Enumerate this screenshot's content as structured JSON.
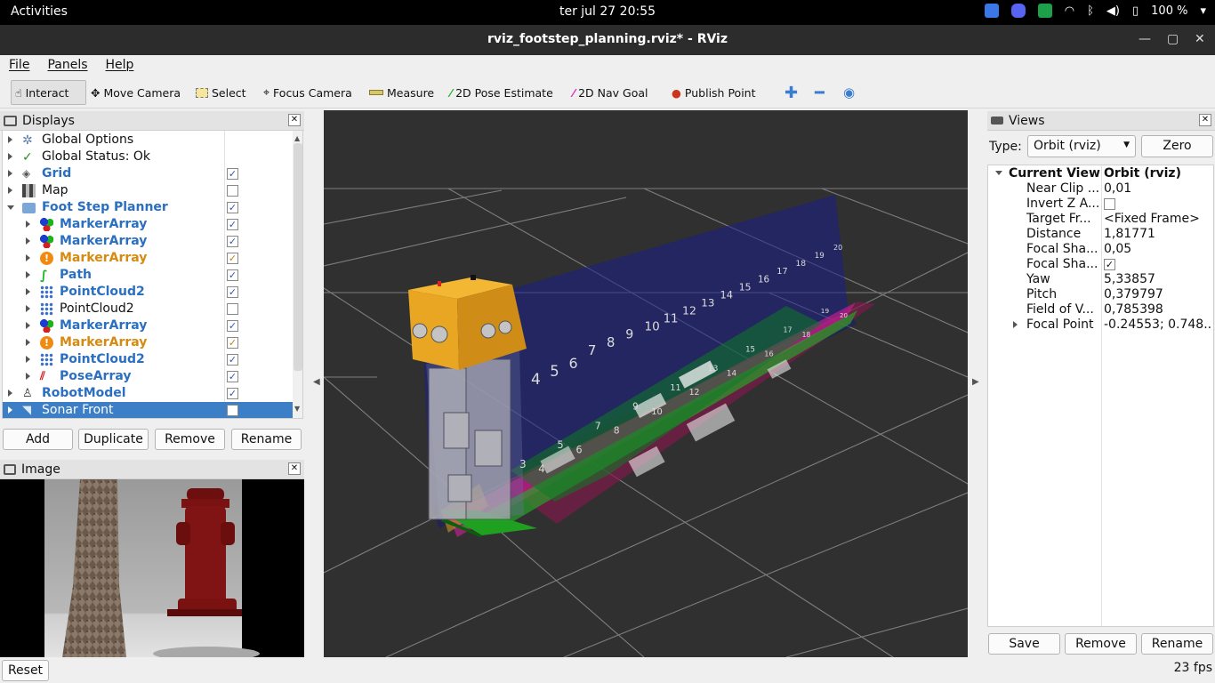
{
  "system_bar": {
    "activities": "Activities",
    "clock": "ter jul 27  20:55",
    "battery": "100 %"
  },
  "window": {
    "title": "rviz_footstep_planning.rviz* - RViz"
  },
  "menu": [
    "File",
    "Panels",
    "Help"
  ],
  "toolbar": {
    "interact": "Interact",
    "move_camera": "Move Camera",
    "select": "Select",
    "focus_camera": "Focus Camera",
    "measure": "Measure",
    "pose_estimate": "2D Pose Estimate",
    "nav_goal": "2D Nav Goal",
    "publish_point": "Publish Point"
  },
  "displays": {
    "title": "Displays",
    "items": [
      {
        "label": "Global Options"
      },
      {
        "label": "Global Status: Ok"
      },
      {
        "label": "Grid",
        "checked": true
      },
      {
        "label": "Map",
        "checked": false
      },
      {
        "label": "Foot Step Planner",
        "checked": true
      },
      {
        "label": "MarkerArray",
        "checked": true
      },
      {
        "label": "MarkerArray",
        "checked": true
      },
      {
        "label": "MarkerArray",
        "checked": true
      },
      {
        "label": "Path",
        "checked": true
      },
      {
        "label": "PointCloud2",
        "checked": true
      },
      {
        "label": "PointCloud2",
        "checked": false
      },
      {
        "label": "MarkerArray",
        "checked": true
      },
      {
        "label": "MarkerArray",
        "checked": true
      },
      {
        "label": "PointCloud2",
        "checked": true
      },
      {
        "label": "PoseArray",
        "checked": true
      },
      {
        "label": "RobotModel",
        "checked": true
      },
      {
        "label": "Sonar Front",
        "checked": false
      }
    ],
    "buttons": {
      "add": "Add",
      "duplicate": "Duplicate",
      "remove": "Remove",
      "rename": "Rename"
    }
  },
  "image_panel": {
    "title": "Image"
  },
  "views": {
    "title": "Views",
    "type_label": "Type:",
    "type_value": "Orbit (rviz)",
    "zero": "Zero",
    "current_view": {
      "key": "Current View",
      "value": "Orbit (rviz)"
    },
    "props": [
      {
        "key": "Near Clip ...",
        "value": "0,01"
      },
      {
        "key": "Invert Z A...",
        "value": ""
      },
      {
        "key": "Target Fr...",
        "value": "<Fixed Frame>"
      },
      {
        "key": "Distance",
        "value": "1,81771"
      },
      {
        "key": "Focal Sha...",
        "value": "0,05"
      },
      {
        "key": "Focal Sha...",
        "value": ""
      },
      {
        "key": "Yaw",
        "value": "5,33857"
      },
      {
        "key": "Pitch",
        "value": "0,379797"
      },
      {
        "key": "Field of V...",
        "value": "0,785398"
      },
      {
        "key": "Focal Point",
        "value": "-0.24553; 0.748..."
      }
    ],
    "buttons": {
      "save": "Save",
      "remove": "Remove",
      "rename": "Rename"
    }
  },
  "status": {
    "reset": "Reset",
    "fps": "23 fps"
  },
  "scene": {
    "step_labels": [
      "4",
      "5",
      "6",
      "7",
      "8",
      "9",
      "10",
      "11",
      "12",
      "13",
      "14",
      "15",
      "16",
      "17",
      "18",
      "19",
      "20"
    ],
    "ground_labels": [
      "3",
      "4",
      "5",
      "6",
      "7",
      "8",
      "9",
      "10",
      "11",
      "12",
      "13",
      "14",
      "15",
      "16",
      "17",
      "18",
      "19",
      "20"
    ]
  },
  "colors": {
    "accent": "#3d7fc6",
    "bg_viewport": "#303030",
    "robot_body": "#e8a623"
  }
}
